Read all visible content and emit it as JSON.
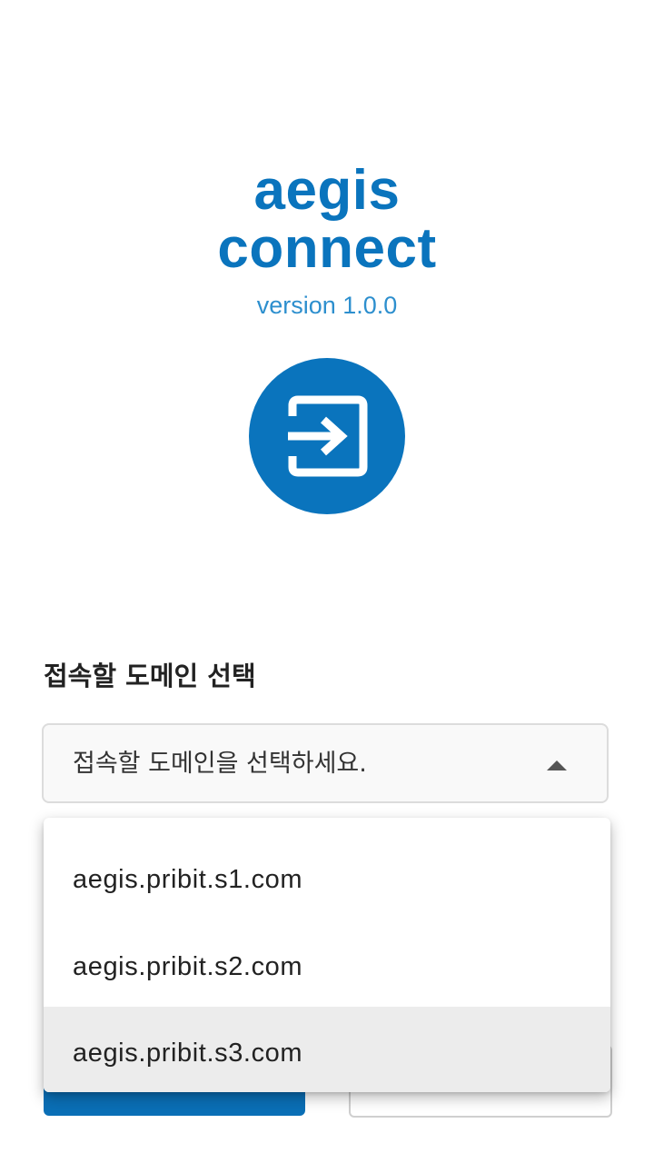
{
  "app": {
    "brand_line1": "aegis",
    "brand_line2": "connect",
    "version": "version 1.0.0",
    "brand_color": "#0a74bd",
    "login_icon": "login-arrow-icon"
  },
  "domain_select": {
    "label": "접속할 도메인 선택",
    "placeholder": "접속할 도메인을 선택하세요.",
    "expanded": true,
    "options": [
      {
        "label": "aegis.pribit.s1.com"
      },
      {
        "label": "aegis.pribit.s2.com"
      },
      {
        "label": "aegis.pribit.s3.com",
        "highlighted": true
      }
    ]
  }
}
